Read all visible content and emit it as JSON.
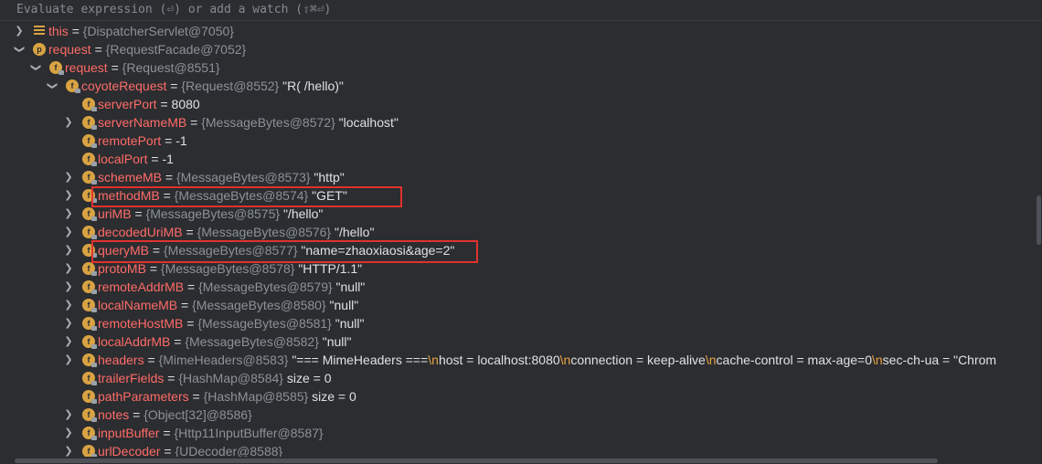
{
  "eval": {
    "placeholder": "Evaluate expression (⏎) or add a watch (⇧⌘⏎)"
  },
  "rows": [
    {
      "name": "this",
      "type": "{DispatcherServlet@7050}",
      "value": ""
    },
    {
      "name": "request",
      "type": "{RequestFacade@7052}",
      "value": ""
    },
    {
      "name": "request",
      "type": "{Request@8551}",
      "value": ""
    },
    {
      "name": "coyoteRequest",
      "type": "{Request@8552}",
      "value": "\"R( /hello)\""
    },
    {
      "name": "serverPort",
      "type": "",
      "value": "8080"
    },
    {
      "name": "serverNameMB",
      "type": "{MessageBytes@8572}",
      "value": "\"localhost\""
    },
    {
      "name": "remotePort",
      "type": "",
      "value": "-1"
    },
    {
      "name": "localPort",
      "type": "",
      "value": "-1"
    },
    {
      "name": "schemeMB",
      "type": "{MessageBytes@8573}",
      "value": "\"http\""
    },
    {
      "name": "methodMB",
      "type": "{MessageBytes@8574}",
      "value": "\"GET\""
    },
    {
      "name": "uriMB",
      "type": "{MessageBytes@8575}",
      "value": "\"/hello\""
    },
    {
      "name": "decodedUriMB",
      "type": "{MessageBytes@8576}",
      "value": "\"/hello\""
    },
    {
      "name": "queryMB",
      "type": "{MessageBytes@8577}",
      "value": "\"name=zhaoxiaosi&age=2\""
    },
    {
      "name": "protoMB",
      "type": "{MessageBytes@8578}",
      "value": "\"HTTP/1.1\""
    },
    {
      "name": "remoteAddrMB",
      "type": "{MessageBytes@8579}",
      "value": "\"null\""
    },
    {
      "name": "localNameMB",
      "type": "{MessageBytes@8580}",
      "value": "\"null\""
    },
    {
      "name": "remoteHostMB",
      "type": "{MessageBytes@8581}",
      "value": "\"null\""
    },
    {
      "name": "localAddrMB",
      "type": "{MessageBytes@8582}",
      "value": "\"null\""
    },
    {
      "name": "headers",
      "type": "{MimeHeaders@8583}",
      "value": "\"=== MimeHeaders ===",
      "segments": [
        "host = localhost:8080",
        "connection = keep-alive",
        "cache-control = max-age=0",
        "sec-ch-ua = \"Chrom"
      ],
      "escape": "\\n"
    },
    {
      "name": "trailerFields",
      "type": "{HashMap@8584}",
      "value": " size = 0"
    },
    {
      "name": "pathParameters",
      "type": "{HashMap@8585}",
      "value": " size = 0"
    },
    {
      "name": "notes",
      "type": "{Object[32]@8586}",
      "value": ""
    },
    {
      "name": "inputBuffer",
      "type": "{Http11InputBuffer@8587}",
      "value": ""
    },
    {
      "name": "urlDecoder",
      "type": "{UDecoder@8588}",
      "value": ""
    }
  ],
  "eq": "=",
  "colors": {
    "name": "#ff6b68",
    "type": "#8c9199",
    "highlight": "#e0322f",
    "icon": "#d9a343"
  }
}
